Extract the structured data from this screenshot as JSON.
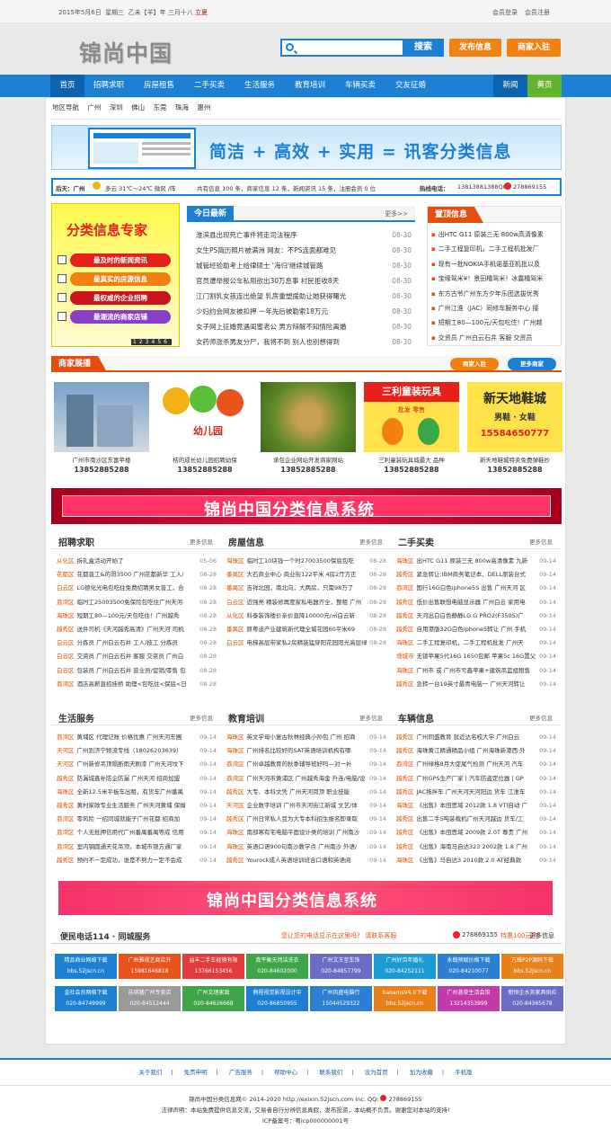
{
  "topbar": {
    "date": "2015年5月6日",
    "weekday": "星期三",
    "lunar": "乙未【羊】年 三月十八",
    "solar_term": "立夏",
    "login": "会员登录",
    "register": "会员注册"
  },
  "logo": "锦尚中国",
  "search": {
    "placeholder": "",
    "button": "搜索"
  },
  "buttons": {
    "post": "发布信息",
    "merchant": "商家入驻"
  },
  "nav": [
    "首页",
    "招聘求职",
    "房屋租售",
    "二手买卖",
    "生活服务",
    "教育培训",
    "车辆买卖",
    "交友征婚",
    "新闻",
    "黄页"
  ],
  "areas": [
    "地区导航",
    "广州",
    "深圳",
    "佛山",
    "东莞",
    "珠海",
    "惠州"
  ],
  "banner1": {
    "slogan": "简洁 + 高效 + 实用 = 讯客分类信息"
  },
  "info": {
    "weather_label": "后天：广州",
    "weather": "多云 31℃～24℃ 微风 /阵",
    "stats": "共有信息 100 条，商家信息 12 条，新闻资讯 15 条，注册会员 0 位",
    "hotline_label": "热线电话：",
    "hotline": "13813881388QQ",
    "qq": "278869155"
  },
  "ad": {
    "title": "分类信息专家",
    "items": [
      "最及时的新闻资讯",
      "最真实的房源信息",
      "最权威的企业招聘",
      "最潮流的商家店铺"
    ],
    "pages": [
      "1",
      "2",
      "3",
      "4",
      "5",
      "6"
    ]
  },
  "news": {
    "title": "今日最新",
    "more": "更多>>",
    "items": [
      {
        "t": "淮滨县出现死亡事件将走司法程序",
        "d": "08-30"
      },
      {
        "t": "女生PS简历照片被满洲 网友：不PS连面都难见",
        "d": "08-30"
      },
      {
        "t": "城管经验助考上给律硕士 '海归'继续城管路",
        "d": "08-30"
      },
      {
        "t": "官员遭举报公车私用欲出30万息事 村民拒收8天",
        "d": "08-30"
      },
      {
        "t": "江门割乳女孩连出绝望 乳房重塑援助让她获得曙光",
        "d": "08-30"
      },
      {
        "t": "少妇约会网友被扣押 一年先后被勒索18万元",
        "d": "08-30"
      },
      {
        "t": "女子网上征婚竟遇闺蜜老公 男方辩解不知情险离婚",
        "d": "08-30"
      },
      {
        "t": "女药师涨杀男友分尸，我将不到 别人也别想得到",
        "d": "08-30"
      }
    ]
  },
  "top": {
    "title": "置顶信息",
    "items": [
      "出HTC G11 原装三无 800w高清像素",
      "二手工程复印机，二手工程机批发厂",
      "现有一批NOKIA手机诺基亚机批以及",
      "宝缘驾米¥！景田橘驾米！冰露橘驾米",
      "东方古爷广州东方夕年乐团选拔优秀",
      "广州江淮（JAC）同修车服务中心 接",
      "短期工80—100元/天包吃住！广州越",
      "交资员 广州白云石井 客服 交资员"
    ]
  },
  "showcase": {
    "title": "商家展播",
    "enter": "商家入驻",
    "more": "更多商家",
    "items": [
      {
        "n": "广州市南沙区东富苹楼",
        "p": "13852885288"
      },
      {
        "n": "桔的成长幼儿园招聘幼保",
        "p": "13852885288"
      },
      {
        "n": "承包企业网站开发商家网站",
        "p": "13852885288"
      },
      {
        "n": "三利童装玩具城最大 品种",
        "p": "13852885288"
      },
      {
        "n": "新天地鞋城特卖免费弹鞋抄",
        "p": "13852885288"
      }
    ]
  },
  "banner2": "锦尚中国分类信息系统",
  "banner3": "锦尚中国分类信息系统",
  "toy_sign": {
    "line1": "三利童装玩具",
    "line2": "批发 零售"
  },
  "shoe_sign": {
    "line1": "新天地鞋城",
    "line2": "男鞋 · 女鞋",
    "line3": "15584650777"
  },
  "kindergarten_sign": "幼儿园",
  "more": "更多信息",
  "sections": [
    {
      "title": "招聘求职",
      "items": [
        {
          "a": "从化区",
          "t": "拆礼盒活动开始了",
          "d": "05-06"
        },
        {
          "a": "花都区",
          "t": "花都普工&的哥3500 广州花都新华 工人/",
          "d": "08-28"
        },
        {
          "a": "白云区",
          "t": "LG德化光电包吃住免费招聘男女普工，合",
          "d": "08-28"
        },
        {
          "a": "荔湾区",
          "t": "临时工25003500免保险包吃住广州天河",
          "d": "08-28"
        },
        {
          "a": "海珠区",
          "t": "短期工80—100元/天包吃住！广州越秀",
          "d": "08-28"
        },
        {
          "a": "越秀区",
          "t": "送件司机《天河越秀高清》广州天河 司机",
          "d": "08-28"
        },
        {
          "a": "白云区",
          "t": "分拣员 广州白云石井 工人/技工 分拣员",
          "d": "08-28"
        },
        {
          "a": "白云区",
          "t": "交资员 广州白云石井 客服 交资员 广州白",
          "d": "08-28"
        },
        {
          "a": "白云区",
          "t": "包装员 广州白云石井 普业员/促销/零售 包",
          "d": "08-28"
        },
        {
          "a": "荔湾区",
          "t": "酒店高薪直招挂桥 助理<包吃住<保底<日",
          "d": "08-28"
        }
      ]
    },
    {
      "title": "房屋信息",
      "items": [
        {
          "a": "海珠区",
          "t": "临时工10块钱一个时27003500保底包吃",
          "d": "08-28"
        },
        {
          "a": "番禺区",
          "t": "大石商业中心 商业街122平米 4房2厅方正",
          "d": "08-28"
        },
        {
          "a": "番禺区",
          "t": "吉祥北园，南北向，大两房，只需98万了",
          "d": "08-28"
        },
        {
          "a": "白云区",
          "t": "近强亮 精装修再度家私电器齐全，整租 广州",
          "d": "08-28"
        },
        {
          "a": "从化区",
          "t": "科泰装饰楼价亲价直降10000元/㎡白云新",
          "d": "08-28"
        },
        {
          "a": "番禺区",
          "t": "原粤迪产业建筑新代理全城花园60平米69",
          "d": "08-28"
        },
        {
          "a": "白云区",
          "t": "电梯高层带家私2房精装猛穿阳花园阳光高层绿",
          "d": "08-28"
        }
      ]
    },
    {
      "title": "二手买卖",
      "items": [
        {
          "a": "海珠区",
          "t": "出HTC G11 原装三无 800w高清像素 九新",
          "d": "09-14"
        },
        {
          "a": "越秀区",
          "t": "紧急转让:IBM商务笔记本、DELL原装台式",
          "d": "09-14"
        },
        {
          "a": "荔湾区",
          "t": "国行16G白色iphone5S 出售 广州天河 区",
          "d": "09-14"
        },
        {
          "a": "越秀区",
          "t": "低价出售联想电脑显示器 广州白云 家用电",
          "d": "09-14"
        },
        {
          "a": "越秀区",
          "t": "天河出白白色静静LG G PRO2(F350S)广",
          "d": "09-14"
        },
        {
          "a": "越秀区",
          "t": "自用港版32G白色iphone5转让 广州 手机",
          "d": "09-14"
        },
        {
          "a": "海珠区",
          "t": "二手工程复印机，二手工程机批发 广州天",
          "d": "09-14"
        },
        {
          "a": "增城市",
          "t": "无锁苹果5代16G 1650包邮 苹果5c 16G置父",
          "d": "09-14"
        },
        {
          "a": "海珠区",
          "t": "广州市 或 广州市亏鑫苹果+建筑吊篮组租售",
          "d": "09-14"
        },
        {
          "a": "越秀区",
          "t": "急转一台19英寸最青电脑一 广州天河转让",
          "d": "09-14"
        }
      ]
    },
    {
      "title": "生活服务",
      "items": [
        {
          "a": "荔湾区",
          "t": "黄埔区 代理记账 价格优惠 广州天河东圃",
          "d": "09-14"
        },
        {
          "a": "天河区",
          "t": "广州到济宁物流专线（18026203639）",
          "d": "09-14"
        },
        {
          "a": "天河区",
          "t": "广州新修吊顶隔断雨天刷漆 广州天河坟下",
          "d": "09-14"
        },
        {
          "a": "越秀区",
          "t": "防漏城鑫补防企防漏 广州天河 招商加盟",
          "d": "09-14"
        },
        {
          "a": "海珠区",
          "t": "全新12.5米平板车出租，有货车广州番禺",
          "d": "09-14"
        },
        {
          "a": "越秀区",
          "t": "黄村家政专业生活服务 广州天河黄埔 保姆",
          "d": "09-14"
        },
        {
          "a": "荔湾区",
          "t": "零风险 一招同城就能子广州花都 招商加",
          "d": "09-14"
        },
        {
          "a": "荔湾区",
          "t": "个人无抵押信用代广州番禺番禺等成 信用",
          "d": "09-14"
        },
        {
          "a": "荔湾区",
          "t": "室内钢圆通天花吊顶，本城市银方通厂家",
          "d": "09-14"
        },
        {
          "a": "越秀区",
          "t": "预约不一定成功，谁是不努力一定不会成",
          "d": "09-14"
        }
      ]
    },
    {
      "title": "教育培训",
      "items": [
        {
          "a": "海珠区",
          "t": "英文学母小复古秋林经典小孙包 广州 招商",
          "d": "09-14"
        },
        {
          "a": "海珠区",
          "t": "广州排名比较好的SAT英语培训机构有哪",
          "d": "09-14"
        },
        {
          "a": "荔湾区",
          "t": "广州卓越教育的秋季辅导班好吗—对一补",
          "d": "09-14"
        },
        {
          "a": "荔湾区",
          "t": "广州天河市黄浦区 广州越秀海金 升连/电脑/设",
          "d": "09-14"
        },
        {
          "a": "越秀区",
          "t": "大专、本科文凭 广州天河岗顶 职业技能",
          "d": "09-14"
        },
        {
          "a": "天河区",
          "t": "企业数字培训 广州市天河街江新城 文艺/体",
          "d": "09-14"
        },
        {
          "a": "越秀区",
          "t": "广州日常私人豆为大专本科招生报名即录取",
          "d": "09-14"
        },
        {
          "a": "海珠区",
          "t": "南部寒有宅电脑平面设计类的培训 广州南沙",
          "d": "09-14"
        },
        {
          "a": "海珠区",
          "t": "英语口语900句南沙教学点 广州南沙 外语/",
          "d": "09-14"
        },
        {
          "a": "越秀区",
          "t": "Yourock成人英语培训班合口语和英语阅",
          "d": "09-14"
        }
      ]
    },
    {
      "title": "车辆信息",
      "items": [
        {
          "a": "越秀区",
          "t": "广州同盛教育 就近达名校大学 广州白云",
          "d": "09-14"
        },
        {
          "a": "越秀区",
          "t": "海珠黄江精通精品小组 广州海珠新港西 外",
          "d": "09-14"
        },
        {
          "a": "荔湾区",
          "t": "广州绿格8月大促尾气检测 广州天河 汽车",
          "d": "09-14"
        },
        {
          "a": "越秀区",
          "t": "广州GPS生产厂家 | 汽车防盗定位器 | GP",
          "d": "09-14"
        },
        {
          "a": "越秀区",
          "t": "JAC拖拌车 广州天河天河阳边 货车 江淮车",
          "d": "09-14"
        },
        {
          "a": "海珠区",
          "t": "《出售》本田思域 2012款 1.8 VTI自动 广",
          "d": "09-14"
        },
        {
          "a": "越秀区",
          "t": "出售二手5吨装载机广州天河越边 货车/工",
          "d": "09-14"
        },
        {
          "a": "越秀区",
          "t": "《出售》本田思域 2009款 2.0T 尊贵 广州",
          "d": "09-14"
        },
        {
          "a": "越秀区",
          "t": "《出售》海南马自达323 2002款 1.8 广州",
          "d": "09-14"
        },
        {
          "a": "海珠区",
          "t": "《出售》马自达3 2010款 2.0 AT经典款",
          "d": "09-14"
        }
      ]
    }
  ],
  "convenience": {
    "title": "便民电话114 · 同城服务",
    "ask": "您让您的电话显示在这里吗？ 请联系客服",
    "qq": "278869155",
    "price": "特惠100元/年",
    "more": "更多信息"
  },
  "tiles": [
    {
      "n": "精品商业网络下载",
      "p": "bbs.52jscn.cn",
      "c": "#1b7fd4"
    },
    {
      "n": "广州雅视艺商店开",
      "p": "15981646818",
      "c": "#e8531c"
    },
    {
      "n": "益丰二手车经销有限",
      "p": "13766153456",
      "c": "#e23b3b"
    },
    {
      "n": "真平衡天然洁洗衣",
      "p": "020-84602000",
      "c": "#3ea549"
    },
    {
      "n": "广州文王至车饰",
      "p": "020-84857799",
      "c": "#6b6cc4"
    },
    {
      "n": "广州好百年婚礼",
      "p": "020-84252111",
      "c": "#1b9bd1"
    },
    {
      "n": "永翰预赋价格下载",
      "p": "020-84210077",
      "c": "#2d7fd4"
    },
    {
      "n": "万维P2P源码下载",
      "p": "bbs.52jscn.cn",
      "c": "#e8801c"
    },
    {
      "n": "金社会员网络下载",
      "p": "020-84749999",
      "c": "#1b7fd4"
    },
    {
      "n": "苏琪猪广州专卖店",
      "p": "020-84512444",
      "c": "#999999"
    },
    {
      "n": "广州文理家政",
      "p": "020-84626668",
      "c": "#3ea549"
    },
    {
      "n": "鼎程视觉影视设计中",
      "p": "020-86850955",
      "c": "#1b7fd4"
    },
    {
      "n": "广州风盛电脑行",
      "p": "15044529322",
      "c": "#2d7fd4"
    },
    {
      "n": "baoamsV4.0下载",
      "p": "bbs.52jscn.cn",
      "c": "#e8801c"
    },
    {
      "n": "广州荟草生活会馆",
      "p": "13214353999",
      "c": "#c23ba8"
    },
    {
      "n": "新恒企水务家具供应",
      "p": "020-84365678",
      "c": "#6b6cc4"
    }
  ],
  "footer": {
    "links": [
      "关于我们",
      "免责申明",
      "广告服务",
      "帮助中心",
      "联系我们",
      "设为首页",
      "加为收藏",
      "手机版"
    ],
    "copyright": "锦尚中国分类信息网© 2014-2020 http://exixin.52jscn.com Inc. QQ:",
    "qq": "278869155",
    "disclaimer": "法律声明：本站免费提供信息交流，交易者自行分辨信息真假，发布投资，本站概不负责。谢谢您对本站的支持!",
    "icp": "ICP备案号：粤icp000000001号"
  }
}
